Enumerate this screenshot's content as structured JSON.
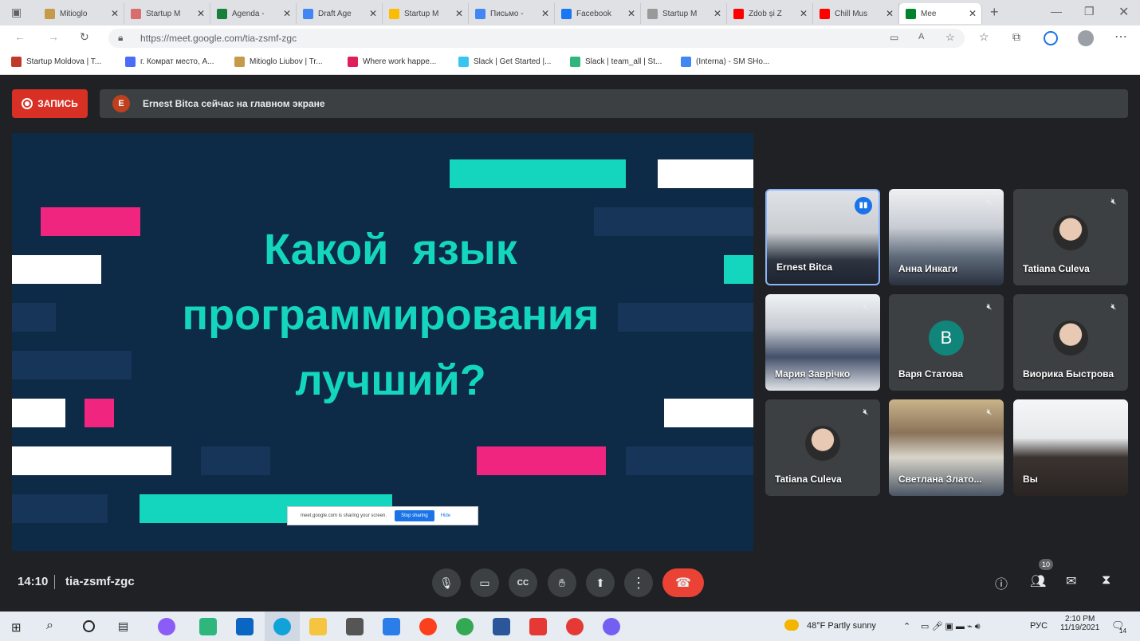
{
  "tabs": [
    {
      "label": "Mitioglo",
      "color": "#c59a4a"
    },
    {
      "label": "Startup M",
      "color": "#d96c6c"
    },
    {
      "label": "Agenda -",
      "color": "#188038"
    },
    {
      "label": "Draft Age",
      "color": "#4285f4"
    },
    {
      "label": "Startup M",
      "color": "#fbbc04"
    },
    {
      "label": "Письмо -",
      "color": "#4285f4"
    },
    {
      "label": "Facebook",
      "color": "#1877f2"
    },
    {
      "label": "Startup M",
      "color": "#999999"
    },
    {
      "label": "Zdob și Z",
      "color": "#ff0000"
    },
    {
      "label": "Chill Mus",
      "color": "#ff0000"
    },
    {
      "label": "Mee",
      "color": "#00832d"
    }
  ],
  "address": {
    "url": "https://meet.google.com/tia-zsmf-zgc"
  },
  "bookmarks": [
    {
      "label": "Startup Moldova | T...",
      "color": "#c0392b"
    },
    {
      "label": "г. Комрат место, А...",
      "color": "#4a6cf7"
    },
    {
      "label": "Mitioglo Liubov | Tr...",
      "color": "#c59a4a"
    },
    {
      "label": "Where work happe...",
      "color": "#e01e5a"
    },
    {
      "label": "Slack | Get Started |...",
      "color": "#36c5f0"
    },
    {
      "label": "Slack | team_all | St...",
      "color": "#2eb67d"
    },
    {
      "label": "(Interna) - SM SHo...",
      "color": "#4285f4"
    }
  ],
  "meet": {
    "record_label": "ЗАПИСЬ",
    "presenter_initial": "E",
    "presenter_notice": "Ernest Bitca сейчас на главном экране",
    "slide": {
      "lines": [
        "Какой  язык",
        "программирования",
        "лучший?"
      ]
    },
    "share_bar": {
      "text": "meet.google.com is sharing your screen.",
      "stop": "Stop sharing",
      "hide": "Hide"
    },
    "participants": [
      {
        "name": "Ernest Bitca",
        "kind": "video",
        "speaking": true
      },
      {
        "name": "Анна Инкаги",
        "kind": "video",
        "muted": true
      },
      {
        "name": "Tatiana Culeva",
        "kind": "avatar",
        "muted": true
      },
      {
        "name": "Мария Заврічко",
        "kind": "video",
        "muted": true
      },
      {
        "name": "Варя Статова",
        "kind": "letter",
        "letter": "B",
        "muted": true
      },
      {
        "name": "Виорика Быстрова",
        "kind": "avatar",
        "muted": true
      },
      {
        "name": "Tatiana Culeva",
        "kind": "avatar",
        "muted": true
      },
      {
        "name": "Светлана Злато...",
        "kind": "video",
        "muted": true
      },
      {
        "name": "Вы",
        "kind": "video"
      }
    ],
    "time": "14:10",
    "meeting_code": "tia-zsmf-zgc",
    "people_count": "10"
  },
  "taskbar": {
    "weather": "48°F  Partly sunny",
    "lang": "РУС",
    "clock_time": "2:10 PM",
    "clock_date": "11/19/2021",
    "notif_count": "14"
  }
}
